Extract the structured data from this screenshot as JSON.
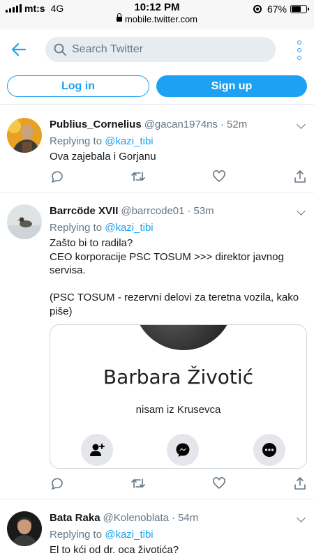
{
  "status_bar": {
    "carrier": "mt:s",
    "network": "4G",
    "time": "10:12 PM",
    "url": "mobile.twitter.com",
    "battery": "67%",
    "battery_level": 0.67
  },
  "header": {
    "search_placeholder": "Search Twitter"
  },
  "auth": {
    "login_label": "Log in",
    "signup_label": "Sign up"
  },
  "tweets": [
    {
      "name": "Publius_Cornelius",
      "handle": "@gacan1974ns",
      "separator": "·",
      "time": "52m",
      "replying_prefix": "Replying to",
      "replying_to": "@kazi_tibi",
      "text": "Ova zajebala i Gorjanu"
    },
    {
      "name": "Barrcöde XVII",
      "handle": "@barrcode01",
      "separator": "·",
      "time": "53m",
      "replying_prefix": "Replying to",
      "replying_to": "@kazi_tibi",
      "text": "Zašto bi to radila?\nCEO korporacije PSC TOSUM >>> direktor javnog servisa.\n\n(PSC TOSUM - rezervni delovi za teretna vozila, kako piše)",
      "card": {
        "name": "Barbara Životić",
        "subtitle": "nisam iz Krusevca"
      }
    },
    {
      "name": "Bata Raka",
      "handle": "@Kolenoblata",
      "separator": "·",
      "time": "54m",
      "replying_prefix": "Replying to",
      "replying_to": "@kazi_tibi",
      "text": "El to kći od dr. oca životića?"
    }
  ],
  "colors": {
    "accent": "#1da1f2",
    "secondary_text": "#657786",
    "primary_text": "#14171a",
    "divider": "#e6ecf0"
  },
  "icons": [
    "back-arrow-icon",
    "search-icon",
    "more-options-icon",
    "chevron-down-icon",
    "reply-icon",
    "retweet-icon",
    "like-icon",
    "share-icon",
    "add-friend-icon",
    "messenger-icon",
    "ellipsis-icon"
  ]
}
